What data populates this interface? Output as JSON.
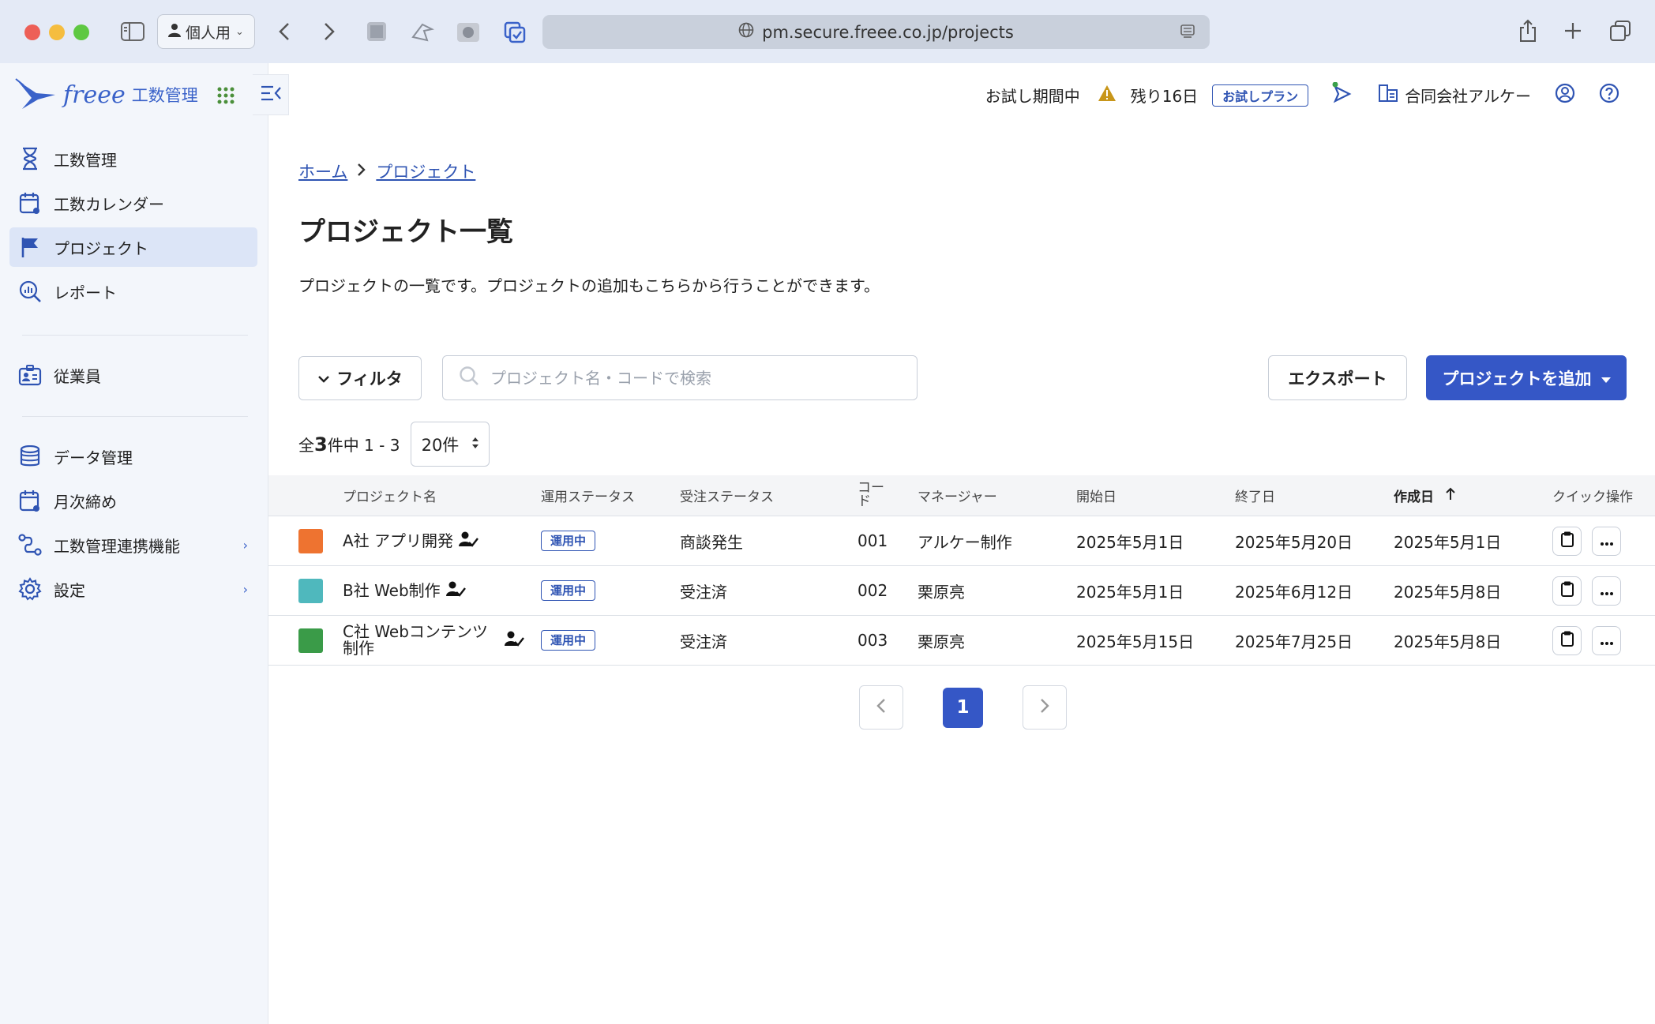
{
  "browser": {
    "profile_label": "個人用",
    "url": "pm.secure.freee.co.jp/projects"
  },
  "app": {
    "logo_text": "freee",
    "logo_sub": "工数管理"
  },
  "sidebar": {
    "items": [
      {
        "label": "工数管理",
        "icon": "hourglass-icon"
      },
      {
        "label": "工数カレンダー",
        "icon": "calendar-icon"
      },
      {
        "label": "プロジェクト",
        "icon": "flag-icon",
        "active": true
      },
      {
        "label": "レポート",
        "icon": "report-search-icon"
      },
      {
        "label": "従業員",
        "icon": "employee-icon"
      },
      {
        "label": "データ管理",
        "icon": "database-icon"
      },
      {
        "label": "月次締め",
        "icon": "calendar-check-icon"
      },
      {
        "label": "工数管理連携機能",
        "icon": "integration-icon",
        "expandable": true
      },
      {
        "label": "設定",
        "icon": "gear-icon",
        "expandable": true
      }
    ]
  },
  "header": {
    "trial_label": "お試し期間中",
    "remaining": "残り16日",
    "plan_badge": "お試しプラン",
    "company": "合同会社アルケー"
  },
  "main": {
    "breadcrumb_home": "ホーム",
    "breadcrumb_current": "プロジェクト",
    "title": "プロジェクト一覧",
    "description": "プロジェクトの一覧です。プロジェクトの追加もこちらから行うことができます。",
    "filter_label": "フィルタ",
    "search_placeholder": "プロジェクト名・コードで検索",
    "export_label": "エクスポート",
    "add_label": "プロジェクトを追加",
    "count_prefix": "全",
    "count_total": "3",
    "count_suffix": "件中 1 - 3",
    "per_page": "20件"
  },
  "table": {
    "columns": {
      "name": "プロジェクト名",
      "op_status": "運用ステータス",
      "order_status": "受注ステータス",
      "code": "コード",
      "manager": "マネージャー",
      "start": "開始日",
      "end": "終了日",
      "created": "作成日",
      "quick": "クイック操作"
    },
    "rows": [
      {
        "color": "#ee7330",
        "name": "A社 アプリ開発",
        "op_status": "運用中",
        "order_status": "商談発生",
        "code": "001",
        "manager": "アルケー制作",
        "start": "2025年5月1日",
        "end": "2025年5月20日",
        "created": "2025年5月1日"
      },
      {
        "color": "#4fb8bd",
        "name": "B社 Web制作",
        "op_status": "運用中",
        "order_status": "受注済",
        "code": "002",
        "manager": "栗原亮",
        "start": "2025年5月1日",
        "end": "2025年6月12日",
        "created": "2025年5月8日"
      },
      {
        "color": "#3a9b48",
        "name": "C社 Webコンテンツ制作",
        "op_status": "運用中",
        "order_status": "受注済",
        "code": "003",
        "manager": "栗原亮",
        "start": "2025年5月15日",
        "end": "2025年7月25日",
        "created": "2025年5月8日"
      }
    ]
  },
  "pagination": {
    "current": "1"
  },
  "colors": {
    "accent": "#3557c6",
    "sidebar_bg": "#f3f6fb",
    "active_bg": "#dce5f7"
  }
}
